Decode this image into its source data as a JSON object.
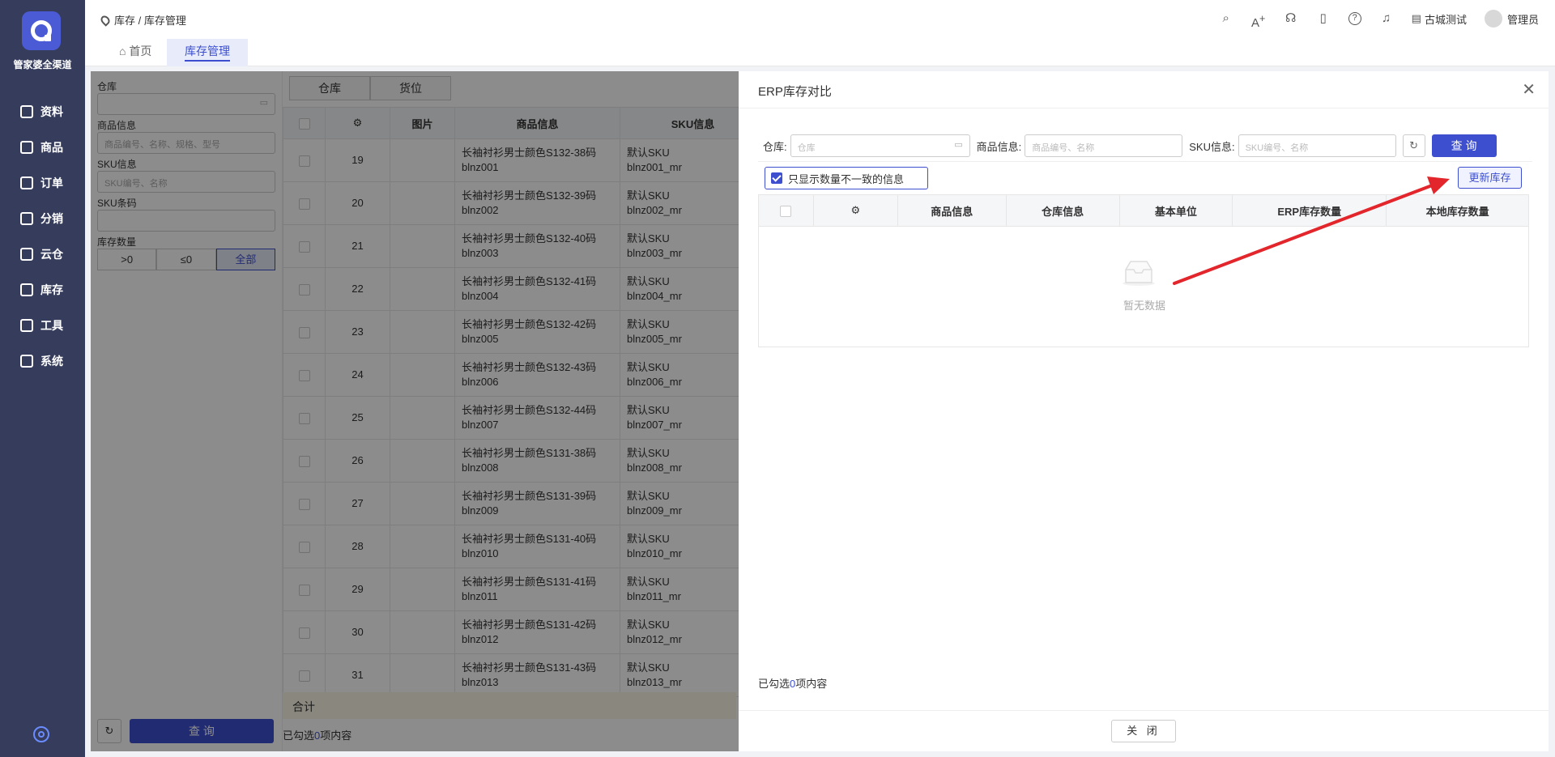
{
  "sidebar": {
    "brand": "管家婆全渠道",
    "items": [
      {
        "label": "资料",
        "icon": "layers-icon"
      },
      {
        "label": "商品",
        "icon": "product-icon"
      },
      {
        "label": "订单",
        "icon": "order-icon"
      },
      {
        "label": "分销",
        "icon": "distribution-icon"
      },
      {
        "label": "云仓",
        "icon": "cloud-warehouse-icon"
      },
      {
        "label": "库存",
        "icon": "inventory-icon"
      },
      {
        "label": "工具",
        "icon": "toolbox-icon"
      },
      {
        "label": "系统",
        "icon": "monitor-icon"
      }
    ]
  },
  "header": {
    "breadcrumb": "库存 / 库存管理",
    "org": "古城测试",
    "user": "管理员"
  },
  "tabs": {
    "home": "首页",
    "active": "库存管理"
  },
  "filter": {
    "warehouse_label": "仓库",
    "product_label": "商品信息",
    "product_placeholder": "商品编号、名称、规格、型号",
    "sku_label": "SKU信息",
    "sku_placeholder": "SKU编号、名称",
    "barcode_label": "SKU条码",
    "qty_label": "库存数量",
    "qty_options": [
      ">0",
      "≤0",
      "全部"
    ],
    "query": "查 询"
  },
  "bg": {
    "seg": [
      "仓库",
      "货位"
    ],
    "headers": [
      "图片",
      "商品信息",
      "SKU信息"
    ],
    "rows": [
      {
        "no": "19",
        "name": "长袖衬衫男士颜色S132-38码",
        "code": "blnz001",
        "sku": "默认SKU",
        "skucode": "blnz001_mr"
      },
      {
        "no": "20",
        "name": "长袖衬衫男士颜色S132-39码",
        "code": "blnz002",
        "sku": "默认SKU",
        "skucode": "blnz002_mr"
      },
      {
        "no": "21",
        "name": "长袖衬衫男士颜色S132-40码",
        "code": "blnz003",
        "sku": "默认SKU",
        "skucode": "blnz003_mr"
      },
      {
        "no": "22",
        "name": "长袖衬衫男士颜色S132-41码",
        "code": "blnz004",
        "sku": "默认SKU",
        "skucode": "blnz004_mr"
      },
      {
        "no": "23",
        "name": "长袖衬衫男士颜色S132-42码",
        "code": "blnz005",
        "sku": "默认SKU",
        "skucode": "blnz005_mr"
      },
      {
        "no": "24",
        "name": "长袖衬衫男士颜色S132-43码",
        "code": "blnz006",
        "sku": "默认SKU",
        "skucode": "blnz006_mr"
      },
      {
        "no": "25",
        "name": "长袖衬衫男士颜色S132-44码",
        "code": "blnz007",
        "sku": "默认SKU",
        "skucode": "blnz007_mr"
      },
      {
        "no": "26",
        "name": "长袖衬衫男士颜色S131-38码",
        "code": "blnz008",
        "sku": "默认SKU",
        "skucode": "blnz008_mr"
      },
      {
        "no": "27",
        "name": "长袖衬衫男士颜色S131-39码",
        "code": "blnz009",
        "sku": "默认SKU",
        "skucode": "blnz009_mr"
      },
      {
        "no": "28",
        "name": "长袖衬衫男士颜色S131-40码",
        "code": "blnz010",
        "sku": "默认SKU",
        "skucode": "blnz010_mr"
      },
      {
        "no": "29",
        "name": "长袖衬衫男士颜色S131-41码",
        "code": "blnz011",
        "sku": "默认SKU",
        "skucode": "blnz011_mr"
      },
      {
        "no": "30",
        "name": "长袖衬衫男士颜色S131-42码",
        "code": "blnz012",
        "sku": "默认SKU",
        "skucode": "blnz012_mr"
      },
      {
        "no": "31",
        "name": "长袖衬衫男士颜色S131-43码",
        "code": "blnz013",
        "sku": "默认SKU",
        "skucode": "blnz013_mr"
      }
    ],
    "total": "合计",
    "selected_prefix": "已勾选",
    "selected_count": "0",
    "selected_suffix": "项内容"
  },
  "drawer": {
    "title": "ERP库存对比",
    "warehouse_label": "仓库:",
    "warehouse_placeholder": "仓库",
    "product_label": "商品信息:",
    "product_placeholder": "商品编号、名称",
    "sku_label": "SKU信息:",
    "sku_placeholder": "SKU编号、名称",
    "query": "查 询",
    "only_diff": "只显示数量不一致的信息",
    "update": "更新库存",
    "columns": [
      "商品信息",
      "仓库信息",
      "基本单位",
      "ERP库存数量",
      "本地库存数量"
    ],
    "empty": "暂无数据",
    "selected_prefix": "已勾选",
    "selected_count": "0",
    "selected_suffix": "项内容",
    "close": "关 闭"
  },
  "colors": {
    "accent": "#3d4fcf",
    "sidebar": "#363c5c",
    "annotation_arrow": "#e3262b"
  }
}
